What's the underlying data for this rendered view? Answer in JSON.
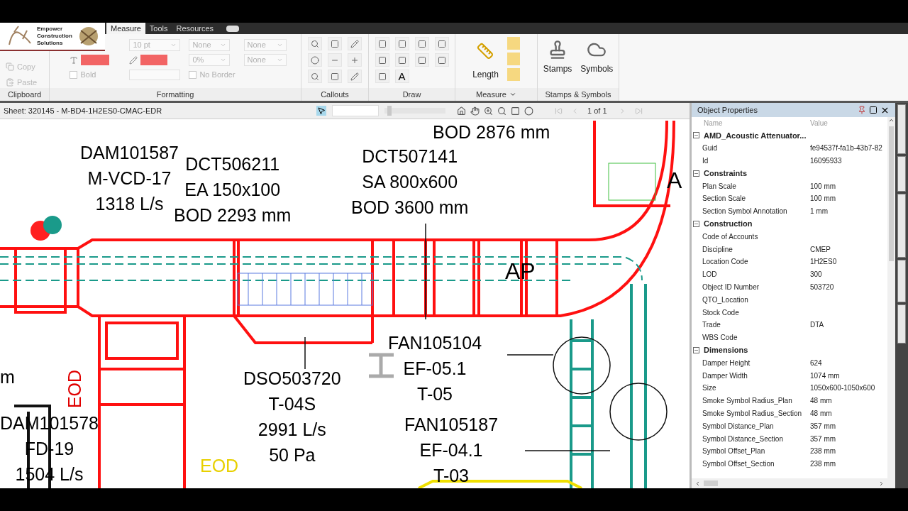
{
  "ribbon": {
    "tabs": [
      {
        "label": "Measure",
        "selected": true
      },
      {
        "label": "Tools",
        "selected": false
      },
      {
        "label": "Resources",
        "selected": false
      }
    ],
    "logo": [
      "Empower",
      "Construction",
      "Solutions"
    ],
    "clipboard": {
      "label": "Clipboard",
      "items": [
        {
          "label": "Copy",
          "disabled": true
        },
        {
          "label": "Paste",
          "disabled": true
        }
      ]
    },
    "formatting": {
      "label": "Formatting",
      "font_size": "10 pt",
      "hatch": "None",
      "opacity": "0%",
      "line_start": "None",
      "line_end": "None",
      "bold": {
        "label": "Bold",
        "checked": false
      },
      "no_border": {
        "label": "No Border",
        "checked": false
      }
    },
    "callouts": {
      "label": "Callouts"
    },
    "draw": {
      "label": "Draw",
      "text_tool": "A"
    },
    "measure": {
      "label": "Measure",
      "length": "Length"
    },
    "stamps": {
      "label": "Stamps & Symbols",
      "items": [
        "Stamps",
        "Symbols"
      ]
    }
  },
  "toolbar": {
    "sheet": "Sheet: 320145 - M-BD4-1H2ES0-CMAC-EDR",
    "zoom": {
      "level": 0.05
    },
    "page": "1 of 1"
  },
  "drawing_labels": [
    {
      "lines": [
        "BOD 2876 mm"
      ]
    },
    {
      "lines": [
        "DAM101587",
        "M-VCD-17",
        "1318 L/s"
      ]
    },
    {
      "lines": [
        "DCT506211",
        "EA 150x100",
        "BOD 2293 mm"
      ]
    },
    {
      "lines": [
        "DCT507141",
        "SA 800x600",
        "BOD 3600 mm"
      ]
    },
    {
      "lines": [
        "A"
      ]
    },
    {
      "lines": [
        "AP"
      ]
    },
    {
      "lines": [
        "FAN105104",
        "EF-05.1",
        "T-05"
      ]
    },
    {
      "lines": [
        "m"
      ]
    },
    {
      "lines": [
        "EOD"
      ]
    },
    {
      "lines": [
        "DSO503720",
        "T-04S",
        "2991 L/s",
        "50 Pa"
      ]
    },
    {
      "lines": [
        "DAM101578",
        "FD-19",
        "1504 L/s"
      ]
    },
    {
      "lines": [
        "EOD"
      ]
    },
    {
      "lines": [
        "FAN105187",
        "EF-04.1",
        "T-03"
      ]
    }
  ],
  "properties": {
    "title": "Object Properties",
    "columns": [
      "Name",
      "Value"
    ],
    "sections": [
      {
        "title": "AMD_Acoustic Attenuator...",
        "expanded": true,
        "rows": [
          {
            "name": "Guid",
            "value": "fe94537f-fa1b-43b7-82"
          },
          {
            "name": "Id",
            "value": "16095933"
          }
        ]
      },
      {
        "title": "Constraints",
        "expanded": true,
        "rows": [
          {
            "name": "Plan Scale",
            "value": "100 mm"
          },
          {
            "name": "Section Scale",
            "value": "100 mm"
          },
          {
            "name": "Section Symbol Annotation",
            "value": "1 mm"
          }
        ]
      },
      {
        "title": "Construction",
        "expanded": true,
        "rows": [
          {
            "name": "Code of Accounts",
            "value": ""
          },
          {
            "name": "Discipline",
            "value": "CMEP"
          },
          {
            "name": "Location Code",
            "value": "1H2ES0"
          },
          {
            "name": "LOD",
            "value": "300"
          },
          {
            "name": "Object ID Number",
            "value": "503720"
          },
          {
            "name": "QTO_Location",
            "value": ""
          },
          {
            "name": "Stock Code",
            "value": ""
          },
          {
            "name": "Trade",
            "value": "DTA"
          },
          {
            "name": "WBS Code",
            "value": ""
          }
        ]
      },
      {
        "title": "Dimensions",
        "expanded": true,
        "rows": [
          {
            "name": "Damper Height",
            "value": "624"
          },
          {
            "name": "Damper Width",
            "value": "1074 mm"
          },
          {
            "name": "Size",
            "value": "1050x600-1050x600"
          },
          {
            "name": "Smoke Symbol Radius_Plan",
            "value": "48 mm"
          },
          {
            "name": "Smoke Symbol Radius_Section",
            "value": "48 mm"
          },
          {
            "name": "Symbol Distance_Plan",
            "value": "357 mm"
          },
          {
            "name": "Symbol Distance_Section",
            "value": "357 mm"
          },
          {
            "name": "Symbol Offset_Plan",
            "value": "238 mm"
          },
          {
            "name": "Symbol Offset_Section",
            "value": "238 mm"
          }
        ]
      }
    ]
  }
}
